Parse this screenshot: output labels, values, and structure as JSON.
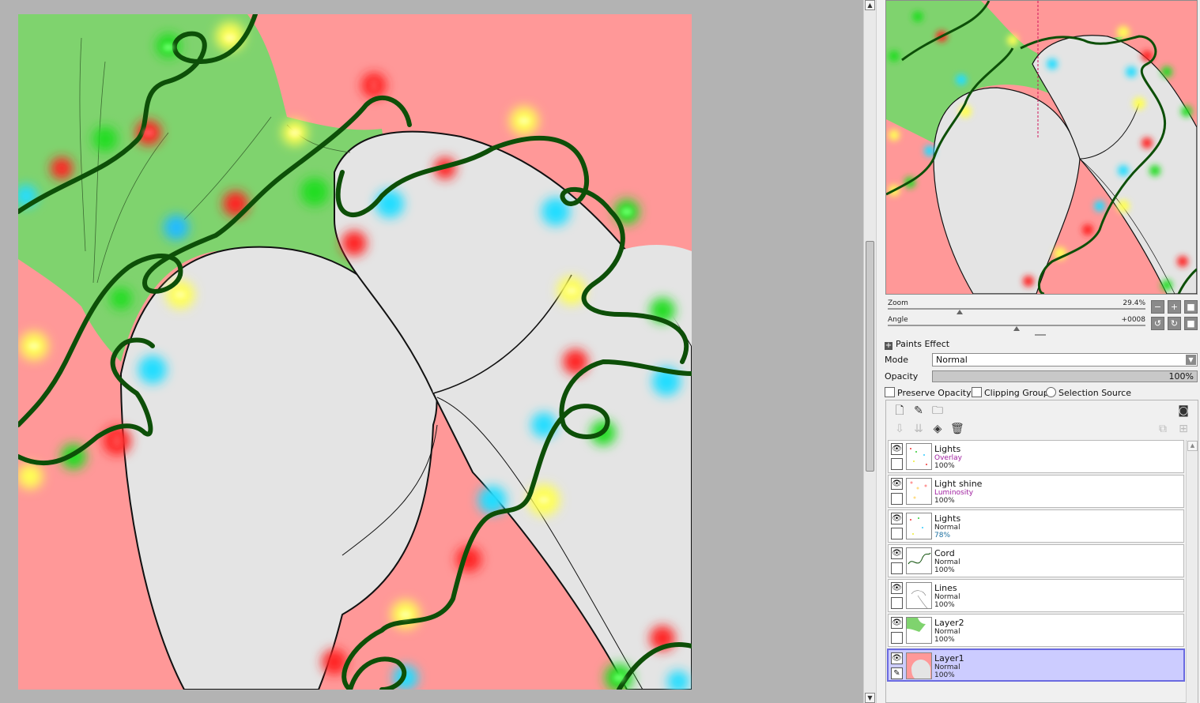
{
  "navigator": {
    "zoom_label": "Zoom",
    "zoom_value": "29.4%",
    "angle_label": "Angle",
    "angle_value": "+0008"
  },
  "paints_effect": {
    "title": "Paints Effect",
    "mode_label": "Mode",
    "mode_value": "Normal",
    "opacity_label": "Opacity",
    "opacity_value": "100%",
    "preserve_opacity": "Preserve Opacity",
    "clipping_group": "Clipping Group",
    "selection_source": "Selection Source"
  },
  "layers": [
    {
      "name": "Lights",
      "mode": "Overlay",
      "opacity": "100%",
      "selected": false
    },
    {
      "name": "Light shine",
      "mode": "Luminosity",
      "opacity": "100%",
      "selected": false
    },
    {
      "name": "Lights",
      "mode": "Normal",
      "opacity": "78%",
      "selected": false
    },
    {
      "name": "Cord",
      "mode": "Normal",
      "opacity": "100%",
      "selected": false
    },
    {
      "name": "Lines",
      "mode": "Normal",
      "opacity": "100%",
      "selected": false
    },
    {
      "name": "Layer2",
      "mode": "Normal",
      "opacity": "100%",
      "selected": false
    },
    {
      "name": "Layer1",
      "mode": "Normal",
      "opacity": "100%",
      "selected": true
    }
  ],
  "icons": {
    "eye": "eye-icon",
    "new_layer": "new-layer-icon",
    "new_linework_layer": "new-linework-layer-icon",
    "new_folder": "new-folder-icon",
    "transfer_down": "transfer-down-icon",
    "merge_down": "merge-down-icon",
    "clear_layer": "clear-layer-icon",
    "delete_layer": "trash-icon",
    "layer_mask": "layer-mask-icon",
    "brush": "brush-icon"
  },
  "colors": {
    "canvas_background": "#ff9898",
    "cloth_green": "#7fd36e",
    "skin_gray": "#e4e4e4",
    "cord_green": "#0d4f08",
    "selected_layer": "#ccccff"
  }
}
